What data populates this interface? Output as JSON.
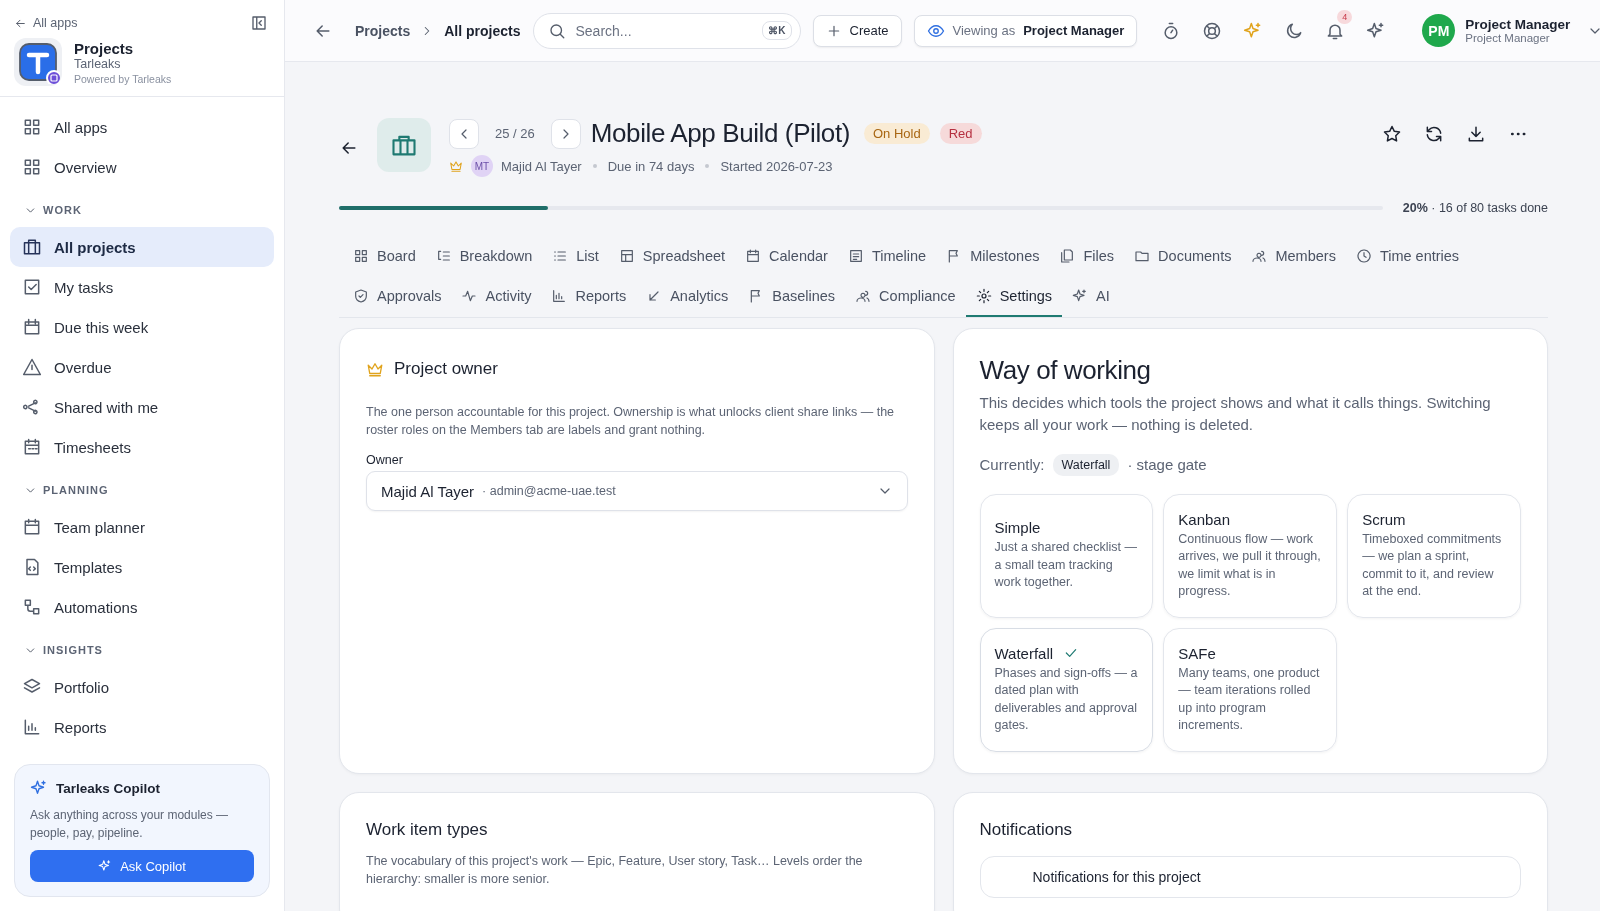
{
  "sidebar": {
    "back_link": "All apps",
    "app": {
      "name": "Projects",
      "org": "Tarleaks",
      "powered_by": "Powered by Tarleaks"
    },
    "top_items": [
      {
        "label": "All apps",
        "selected": false
      },
      {
        "label": "Overview",
        "selected": false
      }
    ],
    "sections": [
      {
        "heading": "WORK",
        "expanded": true,
        "items": [
          {
            "label": "All projects",
            "selected": true
          },
          {
            "label": "My tasks",
            "selected": false
          },
          {
            "label": "Due this week",
            "selected": false
          },
          {
            "label": "Overdue",
            "selected": false
          },
          {
            "label": "Shared with me",
            "selected": false
          },
          {
            "label": "Timesheets",
            "selected": false
          }
        ]
      },
      {
        "heading": "PLANNING",
        "expanded": true,
        "items": [
          {
            "label": "Team planner",
            "selected": false
          },
          {
            "label": "Templates",
            "selected": false
          },
          {
            "label": "Automations",
            "selected": false
          }
        ]
      },
      {
        "heading": "INSIGHTS",
        "expanded": true,
        "items": [
          {
            "label": "Portfolio",
            "selected": false
          },
          {
            "label": "Reports",
            "selected": false
          }
        ]
      }
    ],
    "copilot": {
      "title": "Tarleaks Copilot",
      "text": "Ask anything across your modules — people, pay, pipeline.",
      "button": "Ask Copilot"
    }
  },
  "topbar": {
    "breadcrumb": [
      "Projects",
      "All projects"
    ],
    "search": {
      "placeholder": "Search...",
      "shortcut": "⌘K"
    },
    "create": "Create",
    "viewing_as": {
      "label": "Viewing as",
      "role": "Project Manager"
    },
    "notifications": "4",
    "user": {
      "initials": "PM",
      "name": "Project Manager",
      "role": "Project Manager"
    }
  },
  "project": {
    "counter": "25 / 26",
    "title": "Mobile App Build (Pilot)",
    "badges": [
      {
        "label": "On Hold",
        "color": "#f9ebd4"
      },
      {
        "label": "Red",
        "color": "#f6dada"
      }
    ],
    "owner_initials": "MT",
    "owner": "Majid Al Tayer",
    "due": "Due in 74 days",
    "started": "Started 2026-07-23",
    "progress": {
      "level": 0.2,
      "text": "**20%** · 16 of 80 tasks done"
    }
  },
  "tabs": [
    [
      {
        "label": "Board",
        "selected": false
      },
      {
        "label": "Breakdown",
        "selected": false
      },
      {
        "label": "List",
        "selected": false
      },
      {
        "label": "Spreadsheet",
        "selected": false
      },
      {
        "label": "Calendar",
        "selected": false
      },
      {
        "label": "Timeline",
        "selected": false
      },
      {
        "label": "Milestones",
        "selected": false
      },
      {
        "label": "Files",
        "selected": false
      },
      {
        "label": "Documents",
        "selected": false
      },
      {
        "label": "Members",
        "selected": false
      },
      {
        "label": "Time entries",
        "selected": false
      }
    ],
    [
      {
        "label": "Approvals",
        "selected": false
      },
      {
        "label": "Activity",
        "selected": false
      },
      {
        "label": "Reports",
        "selected": false
      },
      {
        "label": "Analytics",
        "selected": false
      },
      {
        "label": "Baselines",
        "selected": false
      },
      {
        "label": "Compliance",
        "selected": false
      },
      {
        "label": "Settings",
        "selected": true
      },
      {
        "label": "AI",
        "selected": false
      }
    ]
  ],
  "owner_card": {
    "title": "Project owner",
    "text": "The one person accountable for this project. Ownership is what unlocks client share links — the roster roles on the Members tab are labels and grant nothing.",
    "field_label": "Owner",
    "value": "Majid Al Tayer",
    "email": "· admin@acme-uae.test"
  },
  "way_of_working": {
    "title": "Way of working",
    "text": "This decides which tools the project shows and what it calls things. Switching keeps all your work — nothing is deleted.",
    "currently_label": "Currently:",
    "current": "Waterfall",
    "current_note": "· stage gate",
    "options": [
      {
        "name": "Simple",
        "text": "Just a shared checklist — a small team tracking work together.",
        "selected": false
      },
      {
        "name": "Kanban",
        "text": "Continuous flow — work arrives, we pull it through, we limit what is in progress.",
        "selected": false
      },
      {
        "name": "Scrum",
        "text": "Timeboxed commitments — we plan a sprint, commit to it, and review at the end.",
        "selected": false
      },
      {
        "name": "Waterfall",
        "text": "Phases and sign-offs — a dated plan with deliverables and approval gates.",
        "selected": true
      },
      {
        "name": "SAFe",
        "text": "Many teams, one product — team iterations rolled up into program increments.",
        "selected": false
      }
    ]
  },
  "work_item_types": {
    "title": "Work item types",
    "text": "The vocabulary of this project's work — Epic, Feature, User story, Task… Levels order the hierarchy: smaller is more senior."
  },
  "notifications": {
    "title": "Notifications",
    "row": "Notifications for this project"
  }
}
